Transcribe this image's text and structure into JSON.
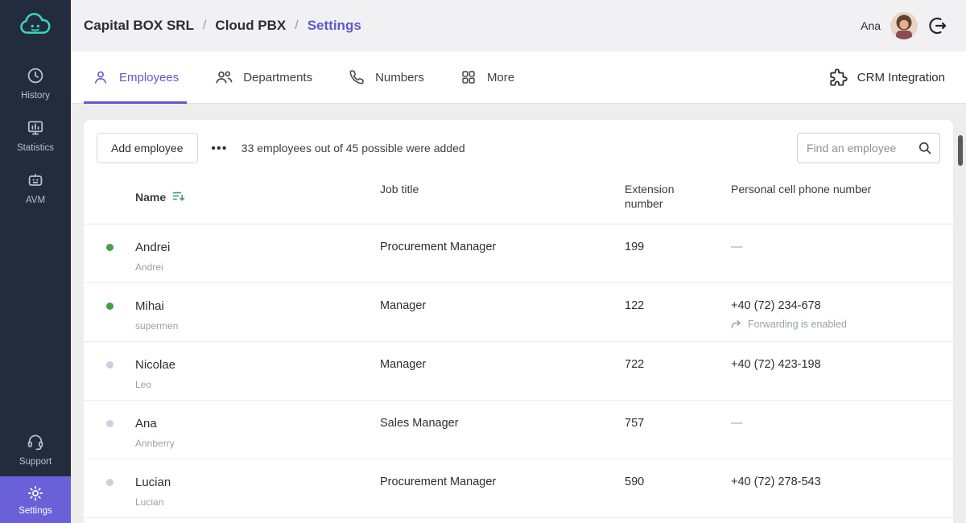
{
  "colors": {
    "accent": "#6158d0",
    "sidebar_bg": "#232c3d",
    "settings_tile": "#6a60d8",
    "logo_teal": "#3ad6c4",
    "online_dot": "#43a047",
    "offline_dot": "#c6d3df",
    "sort_green": "#3f9e6e"
  },
  "sidebar": {
    "items": [
      {
        "label": "History",
        "icon": "clock-icon"
      },
      {
        "label": "Statistics",
        "icon": "bar-chart-icon"
      },
      {
        "label": "AVM",
        "icon": "robot-icon"
      },
      {
        "label": "Support",
        "icon": "headset-icon"
      },
      {
        "label": "Settings",
        "icon": "gear-icon"
      }
    ]
  },
  "header": {
    "breadcrumb": [
      "Capital BOX SRL",
      "Cloud PBX",
      "Settings"
    ],
    "separator": "/",
    "user": "Ana"
  },
  "tabs": [
    {
      "label": "Employees",
      "icon": "person-icon",
      "active": true
    },
    {
      "label": "Departments",
      "icon": "people-icon",
      "active": false
    },
    {
      "label": "Numbers",
      "icon": "phone-icon",
      "active": false
    },
    {
      "label": "More",
      "icon": "grid-icon",
      "active": false
    }
  ],
  "crm_label": "CRM Integration",
  "toolbar": {
    "add_button": "Add employee",
    "more_button": "•••",
    "summary": "33 employees out of 45 possible were added",
    "search_placeholder": "Find an employee"
  },
  "table": {
    "columns": [
      "Name",
      "Job title",
      "Extension number",
      "Personal cell phone number"
    ],
    "rows": [
      {
        "status": "online",
        "name": "Andrei",
        "subtitle": "Andrei",
        "job": "Procurement Manager",
        "ext": "199",
        "phone": "—"
      },
      {
        "status": "online",
        "name": "Mihai",
        "subtitle": "supermen",
        "job": "Manager",
        "ext": "122",
        "phone": "+40 (72) 234-678",
        "note": "Forwarding is enabled"
      },
      {
        "status": "offline",
        "name": "Nicolae",
        "subtitle": "Leo",
        "job": "Manager",
        "ext": "722",
        "phone": "+40 (72) 423-198"
      },
      {
        "status": "offline",
        "name": "Ana",
        "subtitle": "Annberry",
        "job": "Sales Manager",
        "ext": "757",
        "phone": "—"
      },
      {
        "status": "offline",
        "name": "Lucian",
        "subtitle": "Lucian",
        "job": "Procurement Manager",
        "ext": "590",
        "phone": "+40 (72) 278-543"
      }
    ]
  }
}
